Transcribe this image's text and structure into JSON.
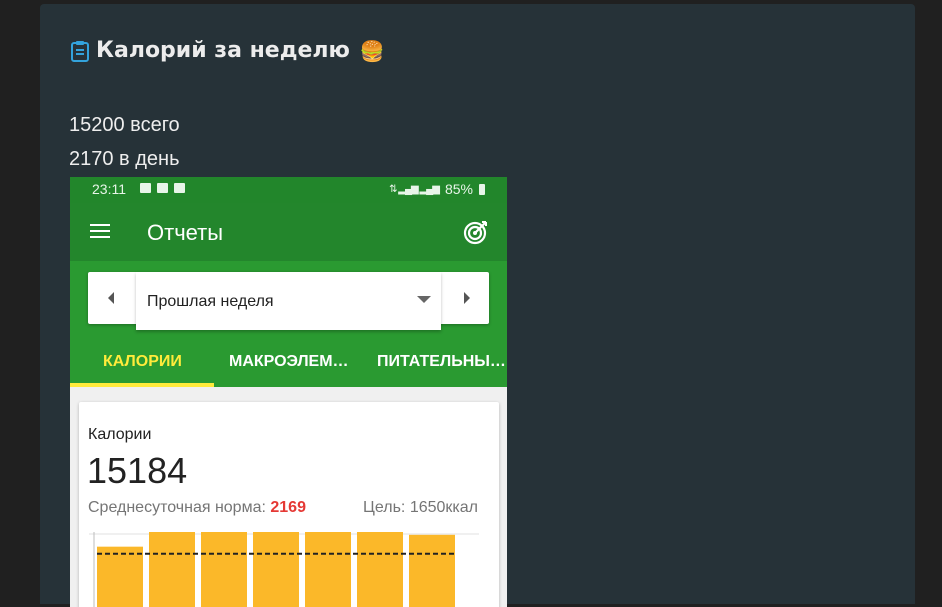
{
  "post": {
    "title": "Калорий за неделю",
    "title_icon": "clipboard-icon",
    "title_emoji": "🍔",
    "total_line": "15200 всего",
    "per_day_line": "2170 в день"
  },
  "phone": {
    "status_bar": {
      "time": "23:11",
      "battery": "85%"
    },
    "toolbar": {
      "title": "Отчеты",
      "menu_icon": "menu-icon",
      "action_icon": "target-icon"
    },
    "period_selector": {
      "selected": "Прошлая неделя"
    },
    "tabs": [
      {
        "label": "КАЛОРИИ",
        "active": true
      },
      {
        "label": "МАКРОЭЛЕМ…",
        "active": false
      },
      {
        "label": "ПИТАТЕЛЬНЫ…",
        "active": false
      }
    ],
    "report": {
      "title": "Калории",
      "total": "15184",
      "avg_label": "Среднесуточная норма:",
      "avg_value": "2169",
      "goal": "Цель: 1650ккал"
    }
  },
  "colors": {
    "statusbar": "#22862b",
    "toolbar": "#23862c",
    "tabs_bg": "#2a9a31",
    "active_tab": "#ffeb3b",
    "bar": "#fbb829",
    "avg_value": "#e53935"
  },
  "chart_data": {
    "type": "bar",
    "categories": [
      "",
      "",
      "",
      "",
      "",
      "",
      ""
    ],
    "values": [
      1800,
      2450,
      2550,
      2280,
      2500,
      2340,
      2050
    ],
    "goal_line": 1650,
    "ylim": [
      0,
      2700
    ]
  }
}
